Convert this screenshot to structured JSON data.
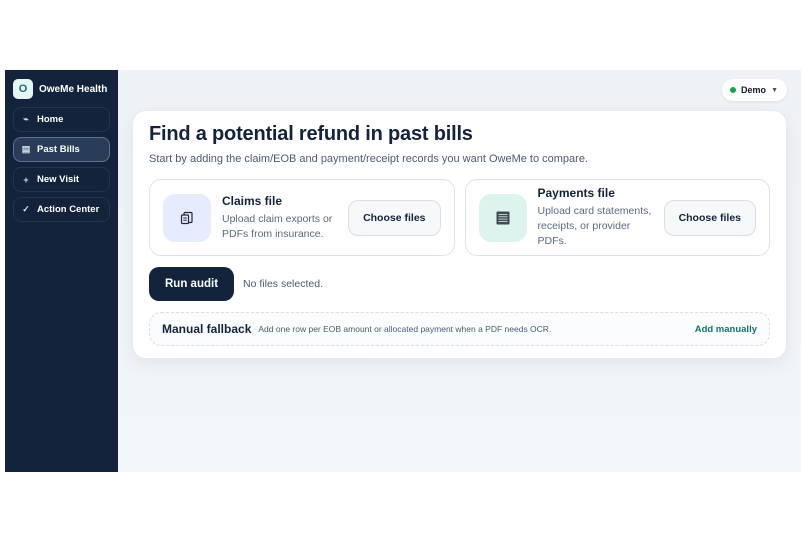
{
  "app": {
    "logo_letter": "O",
    "name": "OweMe Health"
  },
  "sidebar": {
    "items": [
      {
        "icon": "⌁",
        "label": "Home"
      },
      {
        "icon": "▤",
        "label": "Past Bills"
      },
      {
        "icon": "+",
        "label": "New Visit"
      },
      {
        "icon": "✓",
        "label": "Action Center"
      }
    ]
  },
  "user": {
    "label": "Demo",
    "status_color": "#16a34a"
  },
  "page": {
    "title": "Find a potential refund in past bills",
    "subtitle": "Start by adding the claim/EOB and payment/receipt records you want OweMe to compare."
  },
  "claims": {
    "title": "Claims file",
    "description": "Upload claim exports or PDFs from insurance.",
    "button_label": "Choose files",
    "icon": "document-icon"
  },
  "payments": {
    "title": "Payments file",
    "description": "Upload card statements, receipts, or provider PDFs.",
    "button_label": "Choose files",
    "icon": "receipt-icon"
  },
  "audit": {
    "button_label": "Run audit",
    "status": "No files selected."
  },
  "fallback": {
    "title": "Manual fallback",
    "description": "Add one row per EOB amount or allocated payment when a PDF needs OCR.",
    "link_label": "Add manually"
  },
  "colors": {
    "sidebar_bg": "#13233c",
    "accent": "#0f766e",
    "primary_button": "#13233c"
  }
}
